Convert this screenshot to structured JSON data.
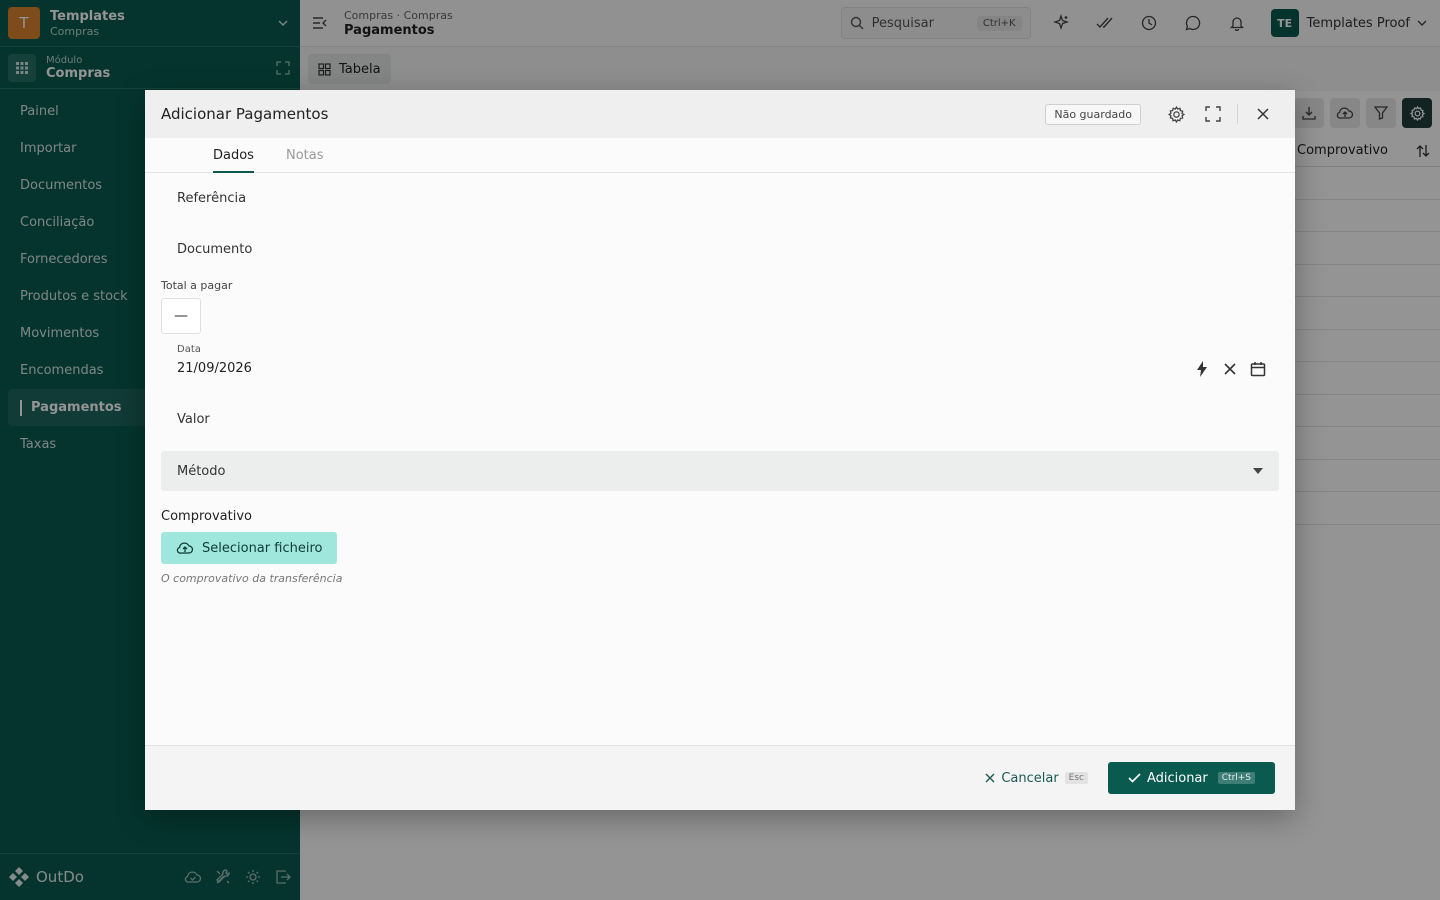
{
  "sidebar": {
    "workspace": {
      "initial": "T",
      "title": "Templates",
      "subtitle": "Compras"
    },
    "module": {
      "label": "Módulo",
      "name": "Compras"
    },
    "items": [
      {
        "label": "Painel"
      },
      {
        "label": "Importar"
      },
      {
        "label": "Documentos"
      },
      {
        "label": "Conciliação"
      },
      {
        "label": "Fornecedores"
      },
      {
        "label": "Produtos e stock"
      },
      {
        "label": "Movimentos"
      },
      {
        "label": "Encomendas"
      },
      {
        "label": "Pagamentos"
      },
      {
        "label": "Taxas"
      }
    ],
    "brand": "OutDo"
  },
  "topbar": {
    "path": "Compras · Compras",
    "title": "Pagamentos",
    "search_placeholder": "Pesquisar",
    "search_shortcut": "Ctrl+K",
    "user_initials": "TE",
    "user_name": "Templates Proof"
  },
  "view": {
    "tab_label": "Tabela"
  },
  "table": {
    "visible_column": "Comprovativo"
  },
  "modal": {
    "title": "Adicionar Pagamentos",
    "status_badge": "Não guardado",
    "tabs": [
      "Dados",
      "Notas"
    ],
    "fields": {
      "referencia": "Referência",
      "documento": "Documento",
      "total_label": "Total a pagar",
      "total_value": "—",
      "data_label": "Data",
      "data_value": "21/09/2026",
      "valor": "Valor",
      "metodo": "Método",
      "comprovativo_label": "Comprovativo",
      "file_button": "Selecionar ficheiro",
      "comprovativo_hint": "O comprovativo da transferência"
    },
    "footer": {
      "cancel_label": "Cancelar",
      "cancel_shortcut": "Esc",
      "add_label": "Adicionar",
      "add_shortcut": "Ctrl+S"
    }
  },
  "colors": {
    "primary": "#0a5a50",
    "accent_light": "#9fe6dc"
  }
}
